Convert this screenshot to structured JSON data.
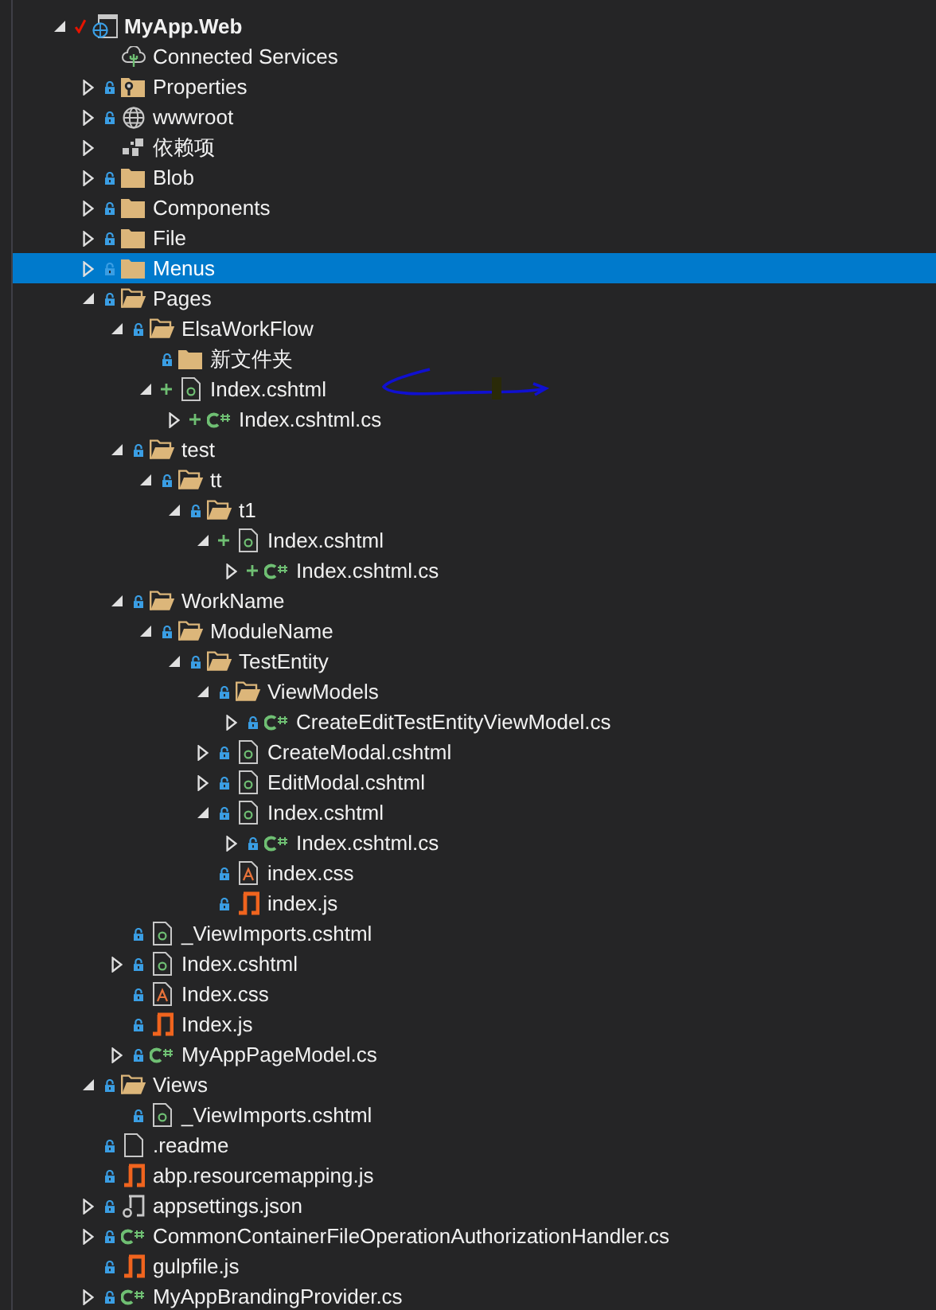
{
  "tree": [
    {
      "label": "MyApp.Web",
      "kind": "project",
      "checked": true,
      "expanded": true,
      "selected": false,
      "children": [
        {
          "label": "Connected Services",
          "kind": "connected",
          "selected": false
        },
        {
          "label": "Properties",
          "kind": "properties",
          "locked": true,
          "expanded": false,
          "selected": false
        },
        {
          "label": "wwwroot",
          "kind": "webroot",
          "locked": true,
          "expanded": false,
          "selected": false
        },
        {
          "label": "依赖项",
          "kind": "dependencies",
          "expanded": false,
          "selected": false
        },
        {
          "label": "Blob",
          "kind": "folder",
          "locked": true,
          "expanded": false,
          "selected": false
        },
        {
          "label": "Components",
          "kind": "folder",
          "locked": true,
          "expanded": false,
          "selected": false
        },
        {
          "label": "File",
          "kind": "folder",
          "locked": true,
          "expanded": false,
          "selected": false
        },
        {
          "label": "Menus",
          "kind": "folder",
          "locked": true,
          "expanded": false,
          "selected": true
        },
        {
          "label": "Pages",
          "kind": "folder",
          "locked": true,
          "expanded": true,
          "selected": false,
          "children": [
            {
              "label": "ElsaWorkFlow",
              "kind": "folder",
              "locked": true,
              "expanded": true,
              "selected": false,
              "children": [
                {
                  "label": "新文件夹",
                  "kind": "folder",
                  "locked": true,
                  "selected": false
                },
                {
                  "label": "Index.cshtml",
                  "kind": "razor",
                  "added": true,
                  "expanded": true,
                  "selected": false,
                  "children": [
                    {
                      "label": "Index.cshtml.cs",
                      "kind": "csharp",
                      "added": true,
                      "expanded": false,
                      "selected": false
                    }
                  ]
                }
              ]
            },
            {
              "label": "test",
              "kind": "folder",
              "locked": true,
              "expanded": true,
              "selected": false,
              "children": [
                {
                  "label": "tt",
                  "kind": "folder",
                  "locked": true,
                  "expanded": true,
                  "selected": false,
                  "children": [
                    {
                      "label": "t1",
                      "kind": "folder",
                      "locked": true,
                      "expanded": true,
                      "selected": false,
                      "children": [
                        {
                          "label": "Index.cshtml",
                          "kind": "razor",
                          "added": true,
                          "expanded": true,
                          "selected": false,
                          "children": [
                            {
                              "label": "Index.cshtml.cs",
                              "kind": "csharp",
                              "added": true,
                              "expanded": false,
                              "selected": false
                            }
                          ]
                        }
                      ]
                    }
                  ]
                }
              ]
            },
            {
              "label": "WorkName",
              "kind": "folder",
              "locked": true,
              "expanded": true,
              "selected": false,
              "children": [
                {
                  "label": "ModuleName",
                  "kind": "folder",
                  "locked": true,
                  "expanded": true,
                  "selected": false,
                  "children": [
                    {
                      "label": "TestEntity",
                      "kind": "folder",
                      "locked": true,
                      "expanded": true,
                      "selected": false,
                      "children": [
                        {
                          "label": "ViewModels",
                          "kind": "folder",
                          "locked": true,
                          "expanded": true,
                          "selected": false,
                          "children": [
                            {
                              "label": "CreateEditTestEntityViewModel.cs",
                              "kind": "csharp",
                              "locked": true,
                              "expanded": false,
                              "selected": false
                            }
                          ]
                        },
                        {
                          "label": "CreateModal.cshtml",
                          "kind": "razor",
                          "locked": true,
                          "expanded": false,
                          "selected": false
                        },
                        {
                          "label": "EditModal.cshtml",
                          "kind": "razor",
                          "locked": true,
                          "expanded": false,
                          "selected": false
                        },
                        {
                          "label": "Index.cshtml",
                          "kind": "razor",
                          "locked": true,
                          "expanded": true,
                          "selected": false,
                          "children": [
                            {
                              "label": "Index.cshtml.cs",
                              "kind": "csharp",
                              "locked": true,
                              "expanded": false,
                              "selected": false
                            }
                          ]
                        },
                        {
                          "label": "index.css",
                          "kind": "css",
                          "locked": true,
                          "selected": false
                        },
                        {
                          "label": "index.js",
                          "kind": "js",
                          "locked": true,
                          "selected": false
                        }
                      ]
                    }
                  ]
                }
              ]
            },
            {
              "label": "_ViewImports.cshtml",
              "kind": "razor",
              "locked": true,
              "selected": false
            },
            {
              "label": "Index.cshtml",
              "kind": "razor",
              "locked": true,
              "expanded": false,
              "selected": false
            },
            {
              "label": "Index.css",
              "kind": "css",
              "locked": true,
              "selected": false
            },
            {
              "label": "Index.js",
              "kind": "js",
              "locked": true,
              "selected": false
            },
            {
              "label": "MyAppPageModel.cs",
              "kind": "csharp",
              "locked": true,
              "expanded": false,
              "selected": false
            }
          ]
        },
        {
          "label": "Views",
          "kind": "folder",
          "locked": true,
          "expanded": true,
          "selected": false,
          "children": [
            {
              "label": "_ViewImports.cshtml",
              "kind": "razor",
              "locked": true,
              "selected": false
            }
          ]
        },
        {
          "label": ".readme",
          "kind": "file",
          "locked": true,
          "selected": false
        },
        {
          "label": "abp.resourcemapping.js",
          "kind": "js",
          "locked": true,
          "selected": false
        },
        {
          "label": "appsettings.json",
          "kind": "json",
          "locked": true,
          "expanded": false,
          "selected": false
        },
        {
          "label": "CommonContainerFileOperationAuthorizationHandler.cs",
          "kind": "csharp",
          "locked": true,
          "expanded": false,
          "selected": false
        },
        {
          "label": "gulpfile.js",
          "kind": "js",
          "locked": true,
          "selected": false
        },
        {
          "label": "MyAppBrandingProvider.cs",
          "kind": "csharp",
          "locked": true,
          "expanded": false,
          "selected": false
        }
      ]
    }
  ]
}
